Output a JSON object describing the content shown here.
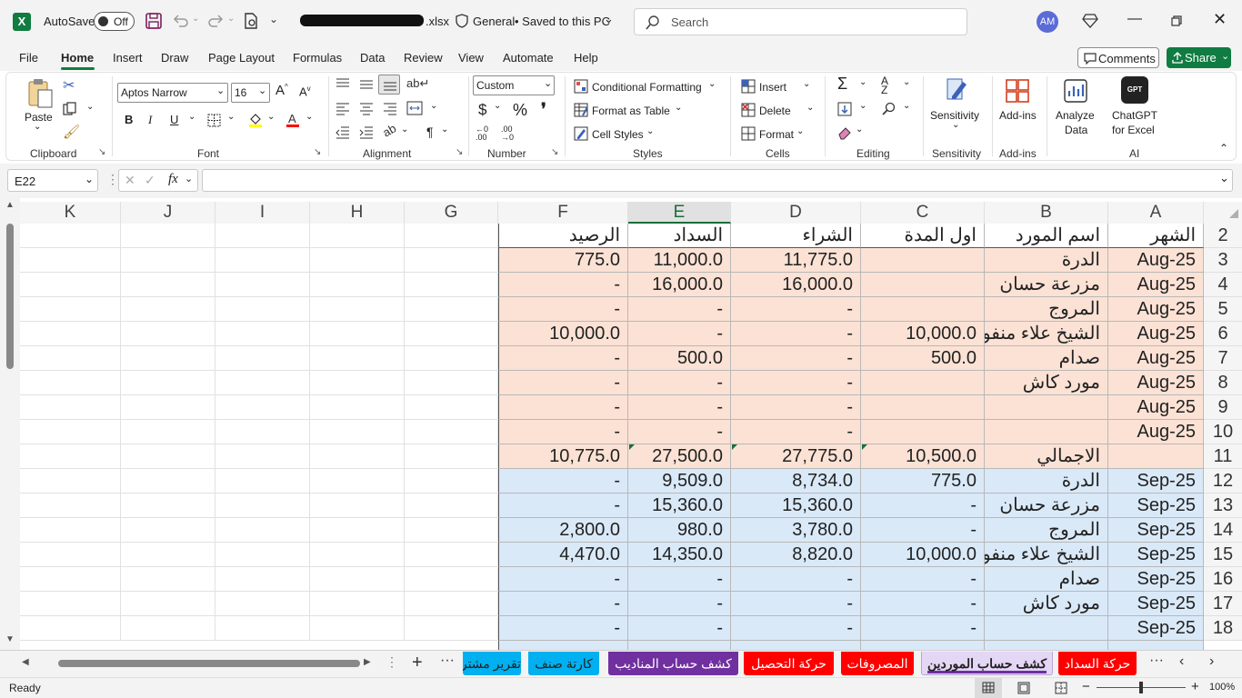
{
  "titlebar": {
    "autosave_label": "AutoSave",
    "autosave_state": "Off",
    "filename": ".xlsx",
    "sensitivity": "General",
    "saved_status": "• Saved to this PC",
    "search_placeholder": "Search",
    "avatar": "AM"
  },
  "tabs": [
    "File",
    "Home",
    "Insert",
    "Draw",
    "Page Layout",
    "Formulas",
    "Data",
    "Review",
    "View",
    "Automate",
    "Help"
  ],
  "comments_label": "Comments",
  "share_label": "Share",
  "ribbon": {
    "clipboard": {
      "paste": "Paste",
      "label": "Clipboard"
    },
    "font": {
      "name": "Aptos Narrow",
      "size": "16",
      "label": "Font"
    },
    "alignment": {
      "label": "Alignment"
    },
    "number": {
      "format": "Custom",
      "label": "Number"
    },
    "styles": {
      "cond": "Conditional Formatting",
      "table": "Format as Table",
      "cellstyles": "Cell Styles",
      "label": "Styles"
    },
    "cells": {
      "insert": "Insert",
      "delete": "Delete",
      "format": "Format",
      "label": "Cells"
    },
    "editing": {
      "label": "Editing"
    },
    "sensitivity": {
      "btn": "Sensitivity",
      "label": "Sensitivity"
    },
    "addins": {
      "btn": "Add-ins",
      "label": "Add-ins"
    },
    "analyze": {
      "line1": "Analyze",
      "line2": "Data"
    },
    "chatgpt": {
      "line1": "ChatGPT",
      "line2": "for Excel",
      "label": "AI"
    }
  },
  "formula_bar": {
    "name_box": "E22",
    "formula": ""
  },
  "columns": [
    "K",
    "J",
    "I",
    "H",
    "G",
    "F",
    "E",
    "D",
    "C",
    "B",
    "A"
  ],
  "rows": [
    {
      "n": "2",
      "A": "الشهر",
      "B": "اسم المورد",
      "C": "اول المدة",
      "D": "الشراء",
      "E": "السداد",
      "F": "الرصيد",
      "band": "none"
    },
    {
      "n": "3",
      "A": "Aug-25",
      "B": "الدرة",
      "C": "",
      "D": "11,775.0",
      "E": "11,000.0",
      "F": "775.0",
      "band": "pink"
    },
    {
      "n": "4",
      "A": "Aug-25",
      "B": "مزرعة حسان",
      "C": "",
      "D": "16,000.0",
      "E": "16,000.0",
      "F": "-",
      "band": "pink"
    },
    {
      "n": "5",
      "A": "Aug-25",
      "B": "المروج",
      "C": "",
      "D": "-",
      "E": "-",
      "F": "-",
      "band": "pink"
    },
    {
      "n": "6",
      "A": "Aug-25",
      "B": "الشيخ علاء منفوحة",
      "C": "10,000.0",
      "D": "-",
      "E": "-",
      "F": "10,000.0",
      "band": "pink"
    },
    {
      "n": "7",
      "A": "Aug-25",
      "B": "صدام",
      "C": "500.0",
      "D": "-",
      "E": "500.0",
      "F": "-",
      "band": "pink"
    },
    {
      "n": "8",
      "A": "Aug-25",
      "B": "مورد كاش",
      "C": "",
      "D": "-",
      "E": "-",
      "F": "-",
      "band": "pink"
    },
    {
      "n": "9",
      "A": "Aug-25",
      "B": "",
      "C": "",
      "D": "-",
      "E": "-",
      "F": "-",
      "band": "pink"
    },
    {
      "n": "10",
      "A": "Aug-25",
      "B": "",
      "C": "",
      "D": "-",
      "E": "-",
      "F": "-",
      "band": "pink"
    },
    {
      "n": "11",
      "A": "",
      "B": "الاجمالي",
      "C": "10,500.0",
      "D": "27,775.0",
      "E": "27,500.0",
      "F": "10,775.0",
      "band": "pink"
    },
    {
      "n": "12",
      "A": "Sep-25",
      "B": "الدرة",
      "C": "775.0",
      "D": "8,734.0",
      "E": "9,509.0",
      "F": "-",
      "band": "blue"
    },
    {
      "n": "13",
      "A": "Sep-25",
      "B": "مزرعة حسان",
      "C": "-",
      "D": "15,360.0",
      "E": "15,360.0",
      "F": "-",
      "band": "blue"
    },
    {
      "n": "14",
      "A": "Sep-25",
      "B": "المروج",
      "C": "-",
      "D": "3,780.0",
      "E": "980.0",
      "F": "2,800.0",
      "band": "blue"
    },
    {
      "n": "15",
      "A": "Sep-25",
      "B": "الشيخ علاء منفوحة",
      "C": "10,000.0",
      "D": "8,820.0",
      "E": "14,350.0",
      "F": "4,470.0",
      "band": "blue"
    },
    {
      "n": "16",
      "A": "Sep-25",
      "B": "صدام",
      "C": "-",
      "D": "-",
      "E": "-",
      "F": "-",
      "band": "blue"
    },
    {
      "n": "17",
      "A": "Sep-25",
      "B": "مورد كاش",
      "C": "-",
      "D": "-",
      "E": "-",
      "F": "-",
      "band": "blue"
    },
    {
      "n": "18",
      "A": "Sep-25",
      "B": "",
      "C": "-",
      "D": "-",
      "E": "-",
      "F": "-",
      "band": "blue"
    }
  ],
  "band_colors": {
    "pink": "#fbe2d5",
    "blue": "#dae9f8"
  },
  "sheet_tabs": [
    {
      "label": "تقرير مشتر",
      "color": "#00b0f0"
    },
    {
      "label": "كارتة صنف",
      "color": "#00b0f0"
    },
    {
      "label": "كشف حساب المناديب",
      "color": "#7030a0"
    },
    {
      "label": "حركة التحصيل",
      "color": "#ff0000"
    },
    {
      "label": "المصروفات",
      "color": "#ff0000"
    },
    {
      "label": "كشف حساب الموردين",
      "color": "#e4d6f5"
    },
    {
      "label": "حركة السداد",
      "color": "#ff0000"
    }
  ],
  "status": {
    "ready": "Ready",
    "zoom": "100%"
  }
}
